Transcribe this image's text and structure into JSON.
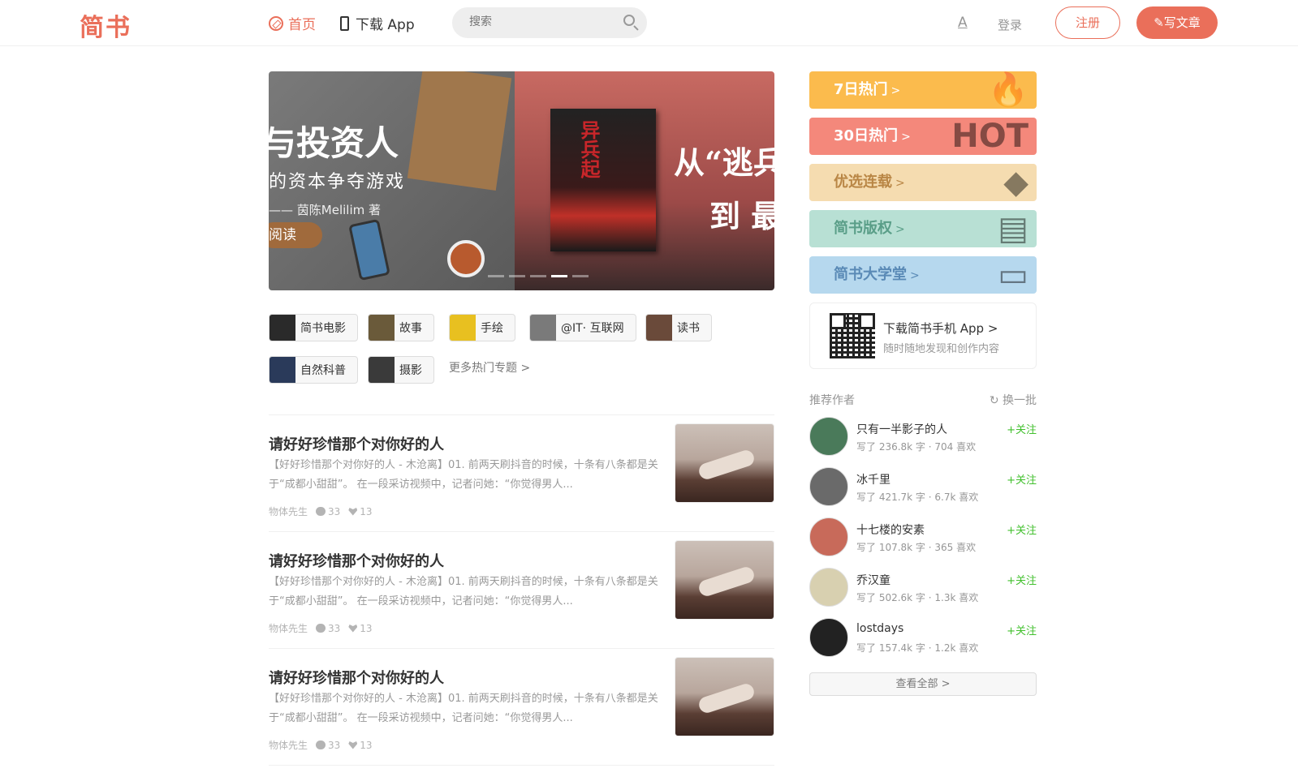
{
  "header": {
    "logo": "简书",
    "nav_home": "首页",
    "nav_app": "下载 App",
    "search_placeholder": "搜索",
    "font_toggle": "A",
    "login": "登录",
    "register": "注册",
    "write": "写文章"
  },
  "banner": {
    "slide1": {
      "title": "与投资人",
      "subtitle": "的资本争夺游戏",
      "author": "—— 茵陈Melilim 著",
      "button": "阅读"
    },
    "slide2": {
      "book_title": "异兵起",
      "quote_line1": "从“逃兵",
      "quote_line2": "到 最"
    }
  },
  "topics": [
    {
      "label": "简书电影",
      "color": "#2a2a2a"
    },
    {
      "label": "故事",
      "color": "#6a5a3a"
    },
    {
      "label": "手绘",
      "color": "#e8c020"
    },
    {
      "label": "@IT· 互联网",
      "color": "#7a7a7a"
    },
    {
      "label": "读书",
      "color": "#6a4a3a"
    },
    {
      "label": "自然科普",
      "color": "#2a3a5a"
    },
    {
      "label": "摄影",
      "color": "#3a3a3a"
    }
  ],
  "more_topics": "更多热门专题 >",
  "articles": [
    {
      "title": "请好好珍惜那个对你好的人",
      "abstract": "【好好珍惜那个对你好的人 - 木沧离】01. 前两天刷抖音的时候，十条有八条都是关于“成都小甜甜”。 在一段采访视频中，记者问她：“你觉得男人...",
      "author": "物体先生",
      "comments": "33",
      "likes": "13"
    },
    {
      "title": "请好好珍惜那个对你好的人",
      "abstract": "【好好珍惜那个对你好的人 - 木沧离】01. 前两天刷抖音的时候，十条有八条都是关于“成都小甜甜”。 在一段采访视频中，记者问她：“你觉得男人...",
      "author": "物体先生",
      "comments": "33",
      "likes": "13"
    },
    {
      "title": "请好好珍惜那个对你好的人",
      "abstract": "【好好珍惜那个对你好的人 - 木沧离】01. 前两天刷抖音的时候，十条有八条都是关于“成都小甜甜”。 在一段采访视频中，记者问她：“你觉得男人...",
      "author": "物体先生",
      "comments": "33",
      "likes": "13"
    }
  ],
  "side": {
    "hot7": "7日热门",
    "hot7_deco": "🔥",
    "hot30": "30日热门",
    "hot30_deco": "HOT",
    "serial": "优选连载",
    "serial_deco": "◆",
    "copyright": "简书版权",
    "copyright_deco": "▤",
    "college": "简书大学堂",
    "college_deco": "▭",
    "arrow": ">",
    "download_title": "下载简书手机 App >",
    "download_sub": "随时随地发现和创作内容",
    "rec_title": "推荐作者",
    "rec_switch": "换一批",
    "follow": "+关注",
    "view_all": "查看全部 >"
  },
  "authors": [
    {
      "name": "只有一半影子的人",
      "stats": "写了 236.8k 字 · 704 喜欢",
      "color": "#4a7a5a"
    },
    {
      "name": "冰千里",
      "stats": "写了 421.7k 字 · 6.7k 喜欢",
      "color": "#6a6a6a"
    },
    {
      "name": "十七楼的安素",
      "stats": "写了 107.8k 字 · 365 喜欢",
      "color": "#c86a5a"
    },
    {
      "name": "乔汉童",
      "stats": "写了 502.6k 字 · 1.3k 喜欢",
      "color": "#d8d0b0"
    },
    {
      "name": "lostdays",
      "stats": "写了 157.4k 字 · 1.2k 喜欢",
      "color": "#222222"
    }
  ]
}
